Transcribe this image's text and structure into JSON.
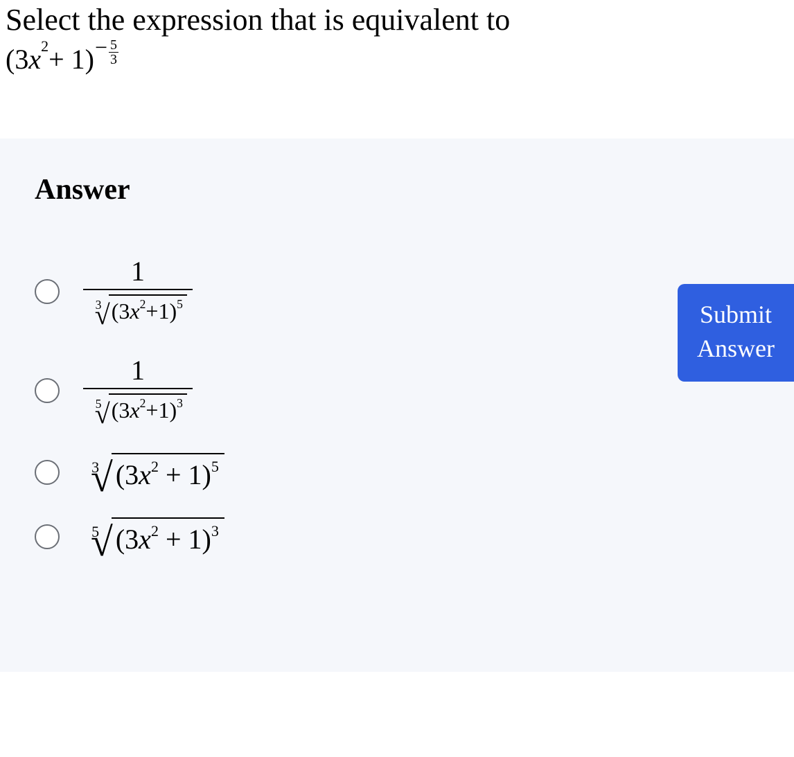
{
  "question": {
    "prompt": "Select the expression that is equivalent to",
    "expression": {
      "base_open": "(3",
      "var": "x",
      "inner_exp": "2",
      "plus_one_close": " + 1)",
      "neg": "−",
      "frac_num": "5",
      "frac_den": "3"
    }
  },
  "answer_heading": "Answer",
  "options": [
    {
      "id": "opt1",
      "type": "fraction_over_root",
      "numerator": "1",
      "root_index": "3",
      "rad_open": "(3",
      "rad_var": "x",
      "rad_inner_exp": "2",
      "rad_plus": "+1)",
      "rad_outer_exp": "5"
    },
    {
      "id": "opt2",
      "type": "fraction_over_root",
      "numerator": "1",
      "root_index": "5",
      "rad_open": "(3",
      "rad_var": "x",
      "rad_inner_exp": "2",
      "rad_plus": "+1)",
      "rad_outer_exp": "3"
    },
    {
      "id": "opt3",
      "type": "root",
      "root_index": "3",
      "rad_open": "(3",
      "rad_var": "x",
      "rad_inner_exp": "2",
      "rad_plus": " + 1)",
      "rad_outer_exp": "5"
    },
    {
      "id": "opt4",
      "type": "root",
      "root_index": "5",
      "rad_open": "(3",
      "rad_var": "x",
      "rad_inner_exp": "2",
      "rad_plus": " + 1)",
      "rad_outer_exp": "3"
    }
  ],
  "submit": {
    "line1": "Submit",
    "line2": "Answer"
  }
}
